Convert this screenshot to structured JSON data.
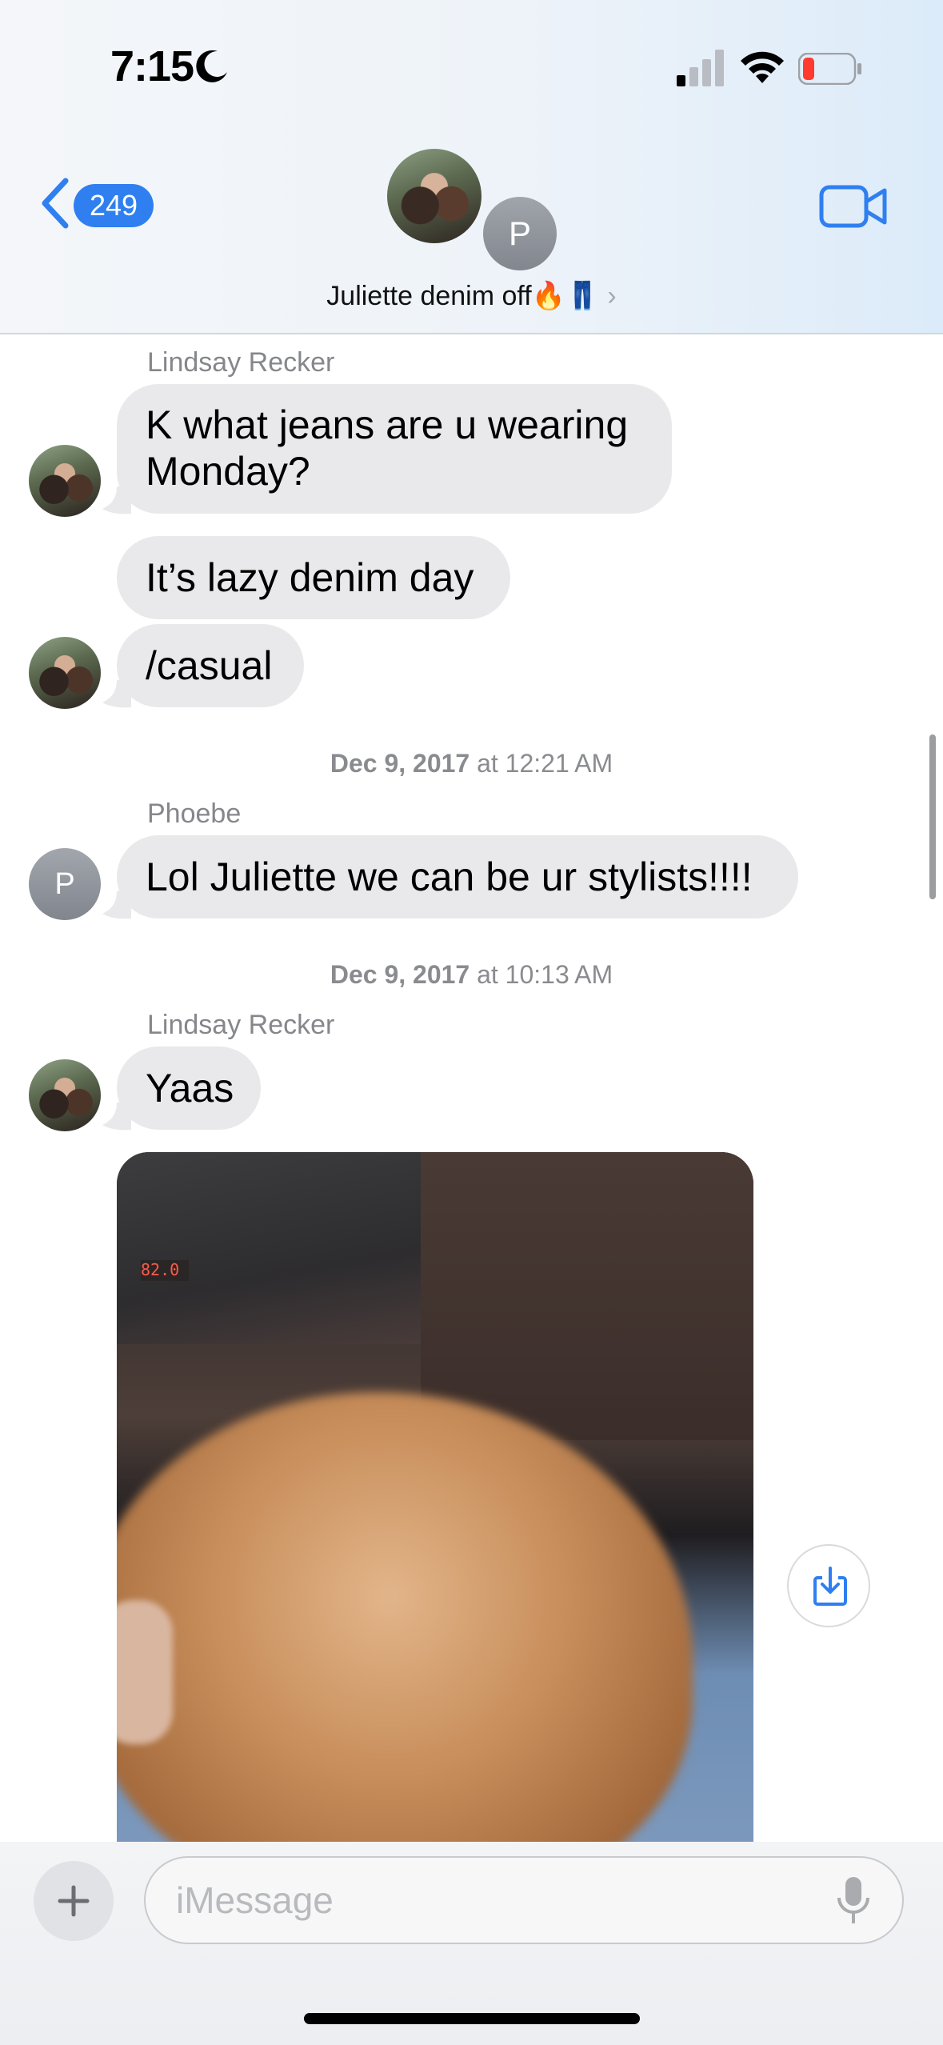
{
  "status_bar": {
    "time": "7:15"
  },
  "header": {
    "back_count": "249",
    "group_name": "Juliette denim off🔥👖",
    "chevron": "›",
    "participant_initial": "P"
  },
  "messages": [
    {
      "sender": "Lindsay Recker",
      "text_lines": [
        "K what jeans are u wearing",
        "Monday?"
      ]
    },
    {
      "text": "It’s lazy denim day"
    },
    {
      "text": "/casual"
    },
    {
      "timestamp_date": "Dec 9, 2017",
      "timestamp_time": "at 12:21 AM"
    },
    {
      "sender": "Phoebe",
      "avatar_initial": "P",
      "text": "Lol Juliette we can be ur stylists!!!!"
    },
    {
      "timestamp_date": "Dec 9, 2017",
      "timestamp_time": "at 10:13 AM"
    },
    {
      "sender": "Lindsay Recker",
      "text": "Yaas"
    }
  ],
  "photo": {
    "display_reading": "82.0"
  },
  "input": {
    "placeholder": "iMessage"
  },
  "icons": {
    "moon": "moon-icon",
    "signal": "cellular-signal-icon",
    "wifi": "wifi-icon",
    "battery": "battery-low-icon",
    "back": "chevron-left-icon",
    "video": "video-camera-icon",
    "save": "save-to-photos-icon",
    "plus": "plus-icon",
    "mic": "microphone-icon"
  },
  "colors": {
    "accent": "#2f7ff0",
    "bubble_gray": "#e9e9eb",
    "battery_low": "#ff3b30"
  }
}
